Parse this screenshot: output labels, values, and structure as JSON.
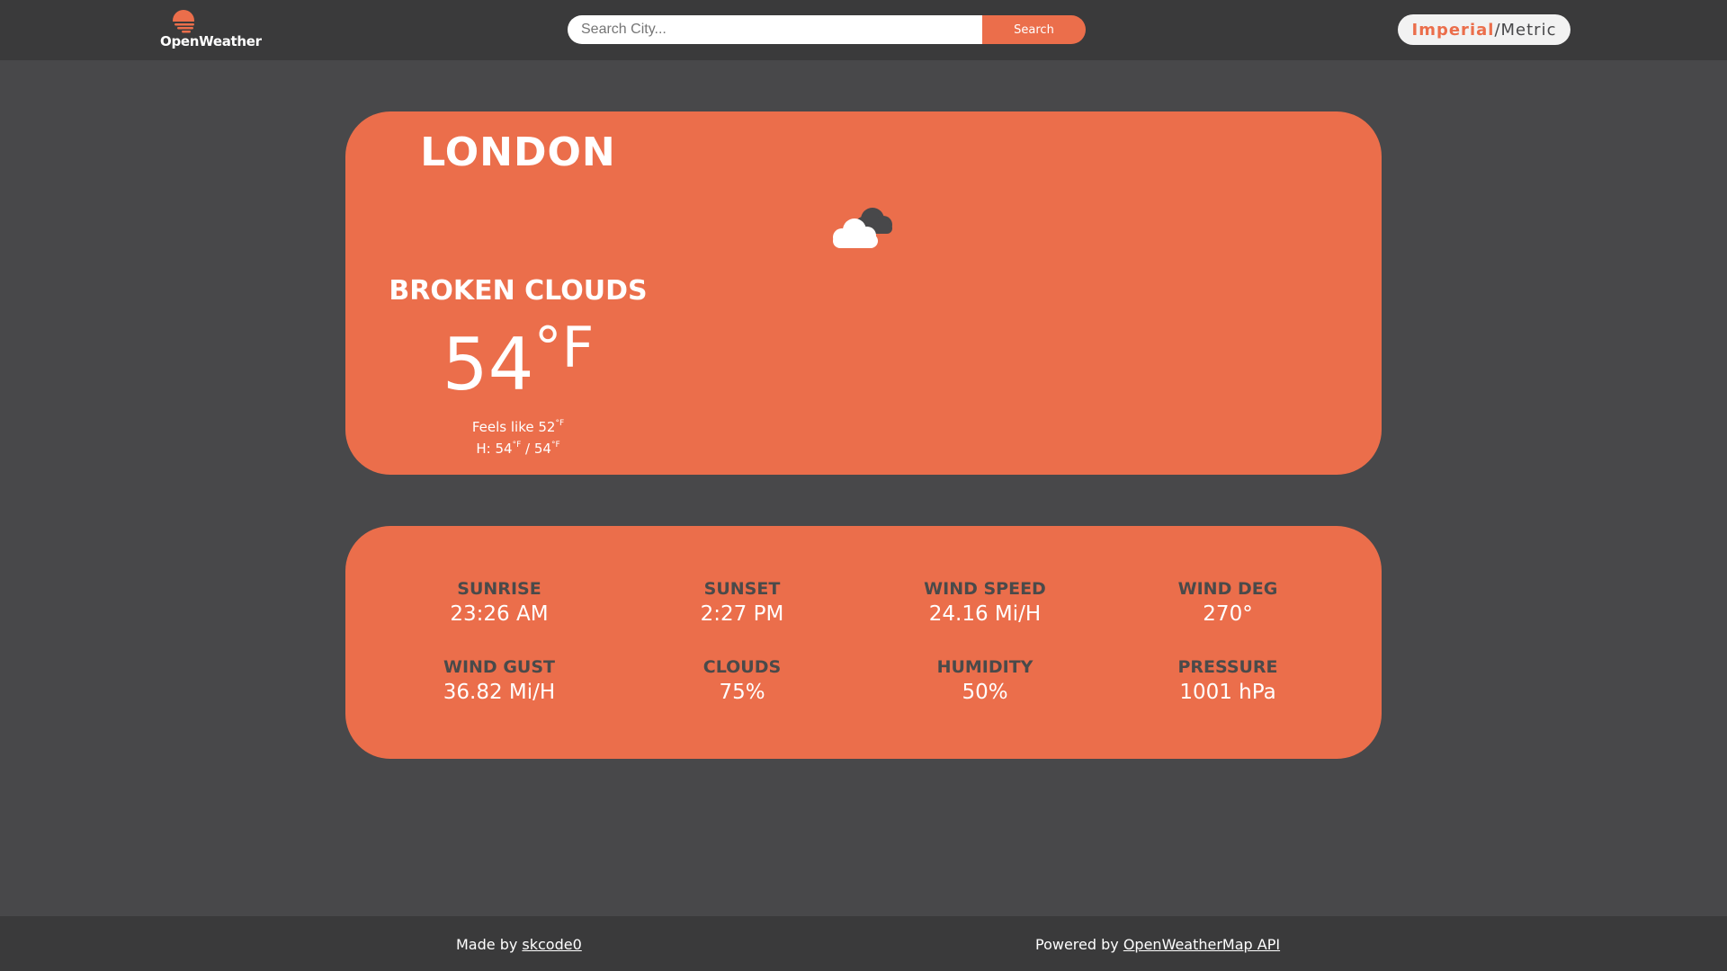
{
  "header": {
    "logo_text": "OpenWeather",
    "search": {
      "placeholder": "Search City...",
      "value": "",
      "button_label": "Search"
    },
    "units": {
      "imperial": "Imperial",
      "separator": "/",
      "metric": "Metric",
      "active": "Imperial"
    }
  },
  "current": {
    "city": "LONDON",
    "icon": "broken-clouds-icon",
    "condition": "BROKEN CLOUDS",
    "temp": "54",
    "temp_unit": "°F",
    "feels_like_label": "Feels like ",
    "feels_like": "52",
    "unit_small": "°F",
    "hilo_label": "H: ",
    "high": "54",
    "hilo_sep": " / ",
    "low": "54"
  },
  "details": [
    {
      "label": "SUNRISE",
      "value": "23:26 AM"
    },
    {
      "label": "SUNSET",
      "value": "2:27 PM"
    },
    {
      "label": "WIND SPEED",
      "value": "24.16 Mi/H"
    },
    {
      "label": "WIND DEG",
      "value": "270°"
    },
    {
      "label": "WIND GUST",
      "value": "36.82 Mi/H"
    },
    {
      "label": "CLOUDS",
      "value": "75%"
    },
    {
      "label": "HUMIDITY",
      "value": "50%"
    },
    {
      "label": "PRESSURE",
      "value": "1001 hPa"
    }
  ],
  "footer": {
    "made_by_label": "Made by ",
    "made_by_link": "skcode0",
    "powered_by_label": "Powered by ",
    "powered_by_link": "OpenWeatherMap API"
  },
  "colors": {
    "accent": "#eb6e4b",
    "background": "#48484a",
    "bar": "#3a3a3b",
    "label_text": "#4a4a4a"
  }
}
